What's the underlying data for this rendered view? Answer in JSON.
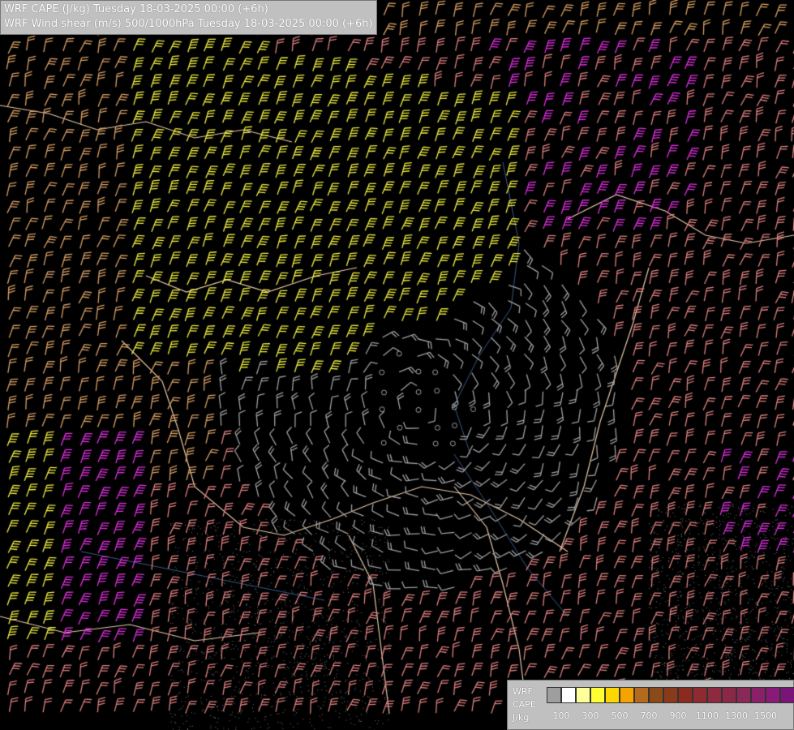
{
  "header": {
    "line1": "WRF CAPE (J/kg) Tuesday 18-03-2025 00:00 (+6h)",
    "line2": "WRF Wind shear (m/s) 500/1000hPa Tuesday 18-03-2025 00:00 (+6h)"
  },
  "legend": {
    "label_1": "WRF",
    "label_2": "CAPE",
    "label_3": "J/kg",
    "colors": [
      "#9e9e9e",
      "#ffffff",
      "#ffff99",
      "#ffff33",
      "#ffd700",
      "#f5a300",
      "#b36a1c",
      "#8b4a1a",
      "#8a3a1a",
      "#8c2a20",
      "#8e2a30",
      "#8e2a40",
      "#8a2848",
      "#8a2858",
      "#8a2068",
      "#8a1a78",
      "#7a1478"
    ],
    "ticks": [
      "100",
      "300",
      "500",
      "700",
      "900",
      "1100",
      "1300",
      "1500"
    ]
  },
  "colors": {
    "low_shear": "#a0a0a0",
    "orange_barb": "#d9a066",
    "yellow_barb": "#f0f040",
    "magenta_barb": "#e030e0",
    "salmon_barb": "#e08080",
    "border": "#e8c8a8",
    "river": "#3a5a8a"
  }
}
